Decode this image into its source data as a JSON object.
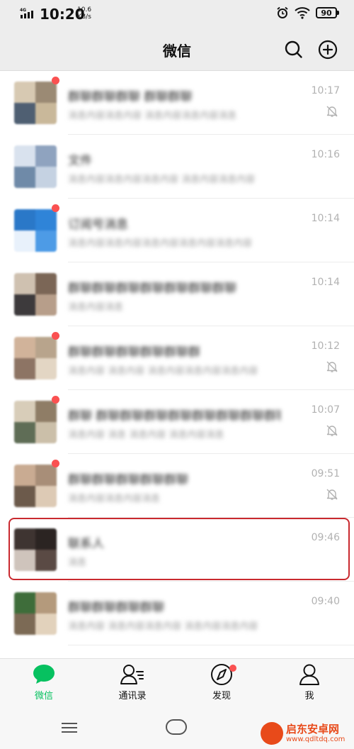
{
  "status_bar": {
    "network": "4G HD",
    "time": "10:20",
    "speed_value": "10.6",
    "speed_unit": "KB/s",
    "battery": "90"
  },
  "header": {
    "title": "微信",
    "search_icon": "search-icon",
    "add_icon": "plus-circle-icon"
  },
  "chats": [
    {
      "name": "群聊群聊群聊 群聊群聊",
      "preview": "消息内容消息内容 消息内容消息内容消息",
      "time": "10:17",
      "unread": true,
      "muted": true,
      "avatar_colors": [
        "#9b8a74",
        "#c9b89a",
        "#4f5f72",
        "#d7c9b2"
      ]
    },
    {
      "name": "文件",
      "preview": "消息内容消息内容消息内容 消息内容消息内容",
      "time": "10:16",
      "unread": false,
      "muted": false,
      "avatar_colors": [
        "#8fa3bf",
        "#c5d2e2",
        "#6f8aa8",
        "#d9e2ee"
      ]
    },
    {
      "name": "订阅号消息",
      "preview": "消息内容消息内容消息内容消息内容消息内容",
      "time": "10:14",
      "unread": true,
      "muted": false,
      "avatar_colors": [
        "#2f84d8",
        "#4d9be6",
        "#e8f1fb",
        "#2a78c8"
      ]
    },
    {
      "name": "群聊群聊群聊群聊群聊群聊群聊",
      "preview": "消息内容消息",
      "time": "10:14",
      "unread": false,
      "muted": false,
      "avatar_colors": [
        "#7b6656",
        "#b79e8a",
        "#3d3a3c",
        "#cfc1b0"
      ]
    },
    {
      "name": "群聊群聊群聊群聊群聊群",
      "preview": "消息内容 消息内容 消息内容消息内容消息内容",
      "time": "10:12",
      "unread": true,
      "muted": true,
      "avatar_colors": [
        "#b8a48c",
        "#e3d6c4",
        "#8d7464",
        "#d1b39a"
      ]
    },
    {
      "name": "群聊 群聊群聊群聊群聊群聊群聊群聊群聊",
      "preview": "消息内容 消息 消息内容 消息内容消息",
      "time": "10:07",
      "unread": true,
      "muted": true,
      "avatar_colors": [
        "#8f7d66",
        "#cbbfa9",
        "#5f6d56",
        "#d8cdb9"
      ]
    },
    {
      "name": "群聊群聊群聊群聊群聊",
      "preview": "消息内容消息内容消息",
      "time": "09:51",
      "unread": true,
      "muted": true,
      "avatar_colors": [
        "#a88e78",
        "#ddcab5",
        "#6c5a4b",
        "#c9ab92"
      ]
    },
    {
      "name": "联系人",
      "preview": "消息",
      "time": "09:46",
      "unread": false,
      "muted": false,
      "avatar_colors": [
        "#2b2422",
        "#5a4a44",
        "#cfc4bc",
        "#3e3431"
      ]
    },
    {
      "name": "群聊群聊群聊群聊",
      "preview": "消息内容 消息内容消息内容 消息内容消息内容",
      "time": "09:40",
      "unread": false,
      "muted": false,
      "avatar_colors": [
        "#b49a7c",
        "#e2d2bc",
        "#7c6a55",
        "#3e6d3a"
      ]
    }
  ],
  "tabs": [
    {
      "label": "微信",
      "icon": "chat-bubble-icon",
      "active": true
    },
    {
      "label": "通讯录",
      "icon": "contacts-icon",
      "active": false
    },
    {
      "label": "发现",
      "icon": "compass-icon",
      "active": false,
      "dot": true
    },
    {
      "label": "我",
      "icon": "person-icon",
      "active": false
    }
  ],
  "nav": {
    "menu_icon": "menu-icon",
    "home_icon": "home-pill-icon"
  },
  "watermark": {
    "title": "启东安卓网",
    "url": "www.qdltdq.com"
  }
}
